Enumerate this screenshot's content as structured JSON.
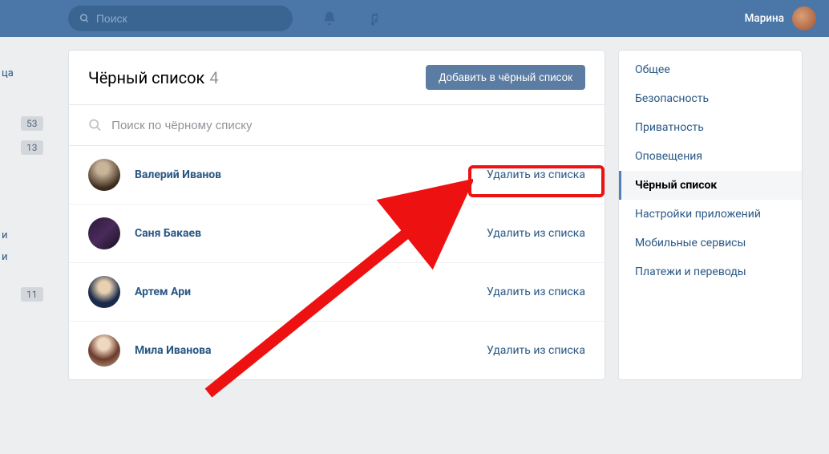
{
  "header": {
    "search_placeholder": "Поиск",
    "username": "Марина"
  },
  "left_sidebar": {
    "label_top": "ца",
    "badge1": "53",
    "badge2": "13",
    "label_mid1": "и",
    "label_mid2": "и",
    "badge3": "11"
  },
  "main": {
    "title": "Чёрный список",
    "count": "4",
    "add_button": "Добавить в чёрный список",
    "search_placeholder": "Поиск по чёрному списку",
    "remove_label": "Удалить из списка",
    "users": [
      {
        "name": "Валерий Иванов"
      },
      {
        "name": "Саня Бакаев"
      },
      {
        "name": "Артем Ари"
      },
      {
        "name": "Мила Иванова"
      }
    ]
  },
  "settings_menu": [
    {
      "label": "Общее",
      "active": false
    },
    {
      "label": "Безопасность",
      "active": false
    },
    {
      "label": "Приватность",
      "active": false
    },
    {
      "label": "Оповещения",
      "active": false
    },
    {
      "label": "Чёрный список",
      "active": true
    },
    {
      "label": "Настройки приложений",
      "active": false
    },
    {
      "label": "Мобильные сервисы",
      "active": false
    },
    {
      "label": "Платежи и переводы",
      "active": false
    }
  ]
}
